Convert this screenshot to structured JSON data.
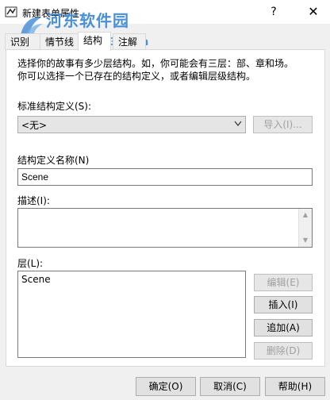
{
  "window": {
    "title": "新建表单属性",
    "help_label": "?",
    "close_label": "✕"
  },
  "watermark": {
    "text": "河东软件园",
    "url": "www.pc0359.cn"
  },
  "tabs": [
    {
      "label": "识别",
      "active": false
    },
    {
      "label": "情节线",
      "active": false
    },
    {
      "label": "结构",
      "active": true
    },
    {
      "label": "注解",
      "active": false
    }
  ],
  "intro": {
    "line1": "选择你的故事有多少层结构。如，你可能会有三层：部、章和场。",
    "line2": "你可以选择一个已存在的结构定义，或者编辑层级结构。"
  },
  "structure_def": {
    "label": "标准结构定义(S):",
    "selected": "<无>",
    "import_label": "导入(I)..."
  },
  "name": {
    "label": "结构定义名称(N)",
    "value": "Scene"
  },
  "description": {
    "label": "描述(I):",
    "value": ""
  },
  "levels": {
    "label": "层(L):",
    "items": [
      "Scene"
    ],
    "edit_label": "编辑(E)",
    "insert_label": "插入(I)",
    "append_label": "追加(A)",
    "delete_label": "删除(D)"
  },
  "footer": {
    "ok_label": "确定(O)",
    "cancel_label": "取消(C)",
    "help_label": "帮助(H)"
  },
  "colors": {
    "watermark": "#4a90d6",
    "disabled_text": "#a0a0a0"
  }
}
